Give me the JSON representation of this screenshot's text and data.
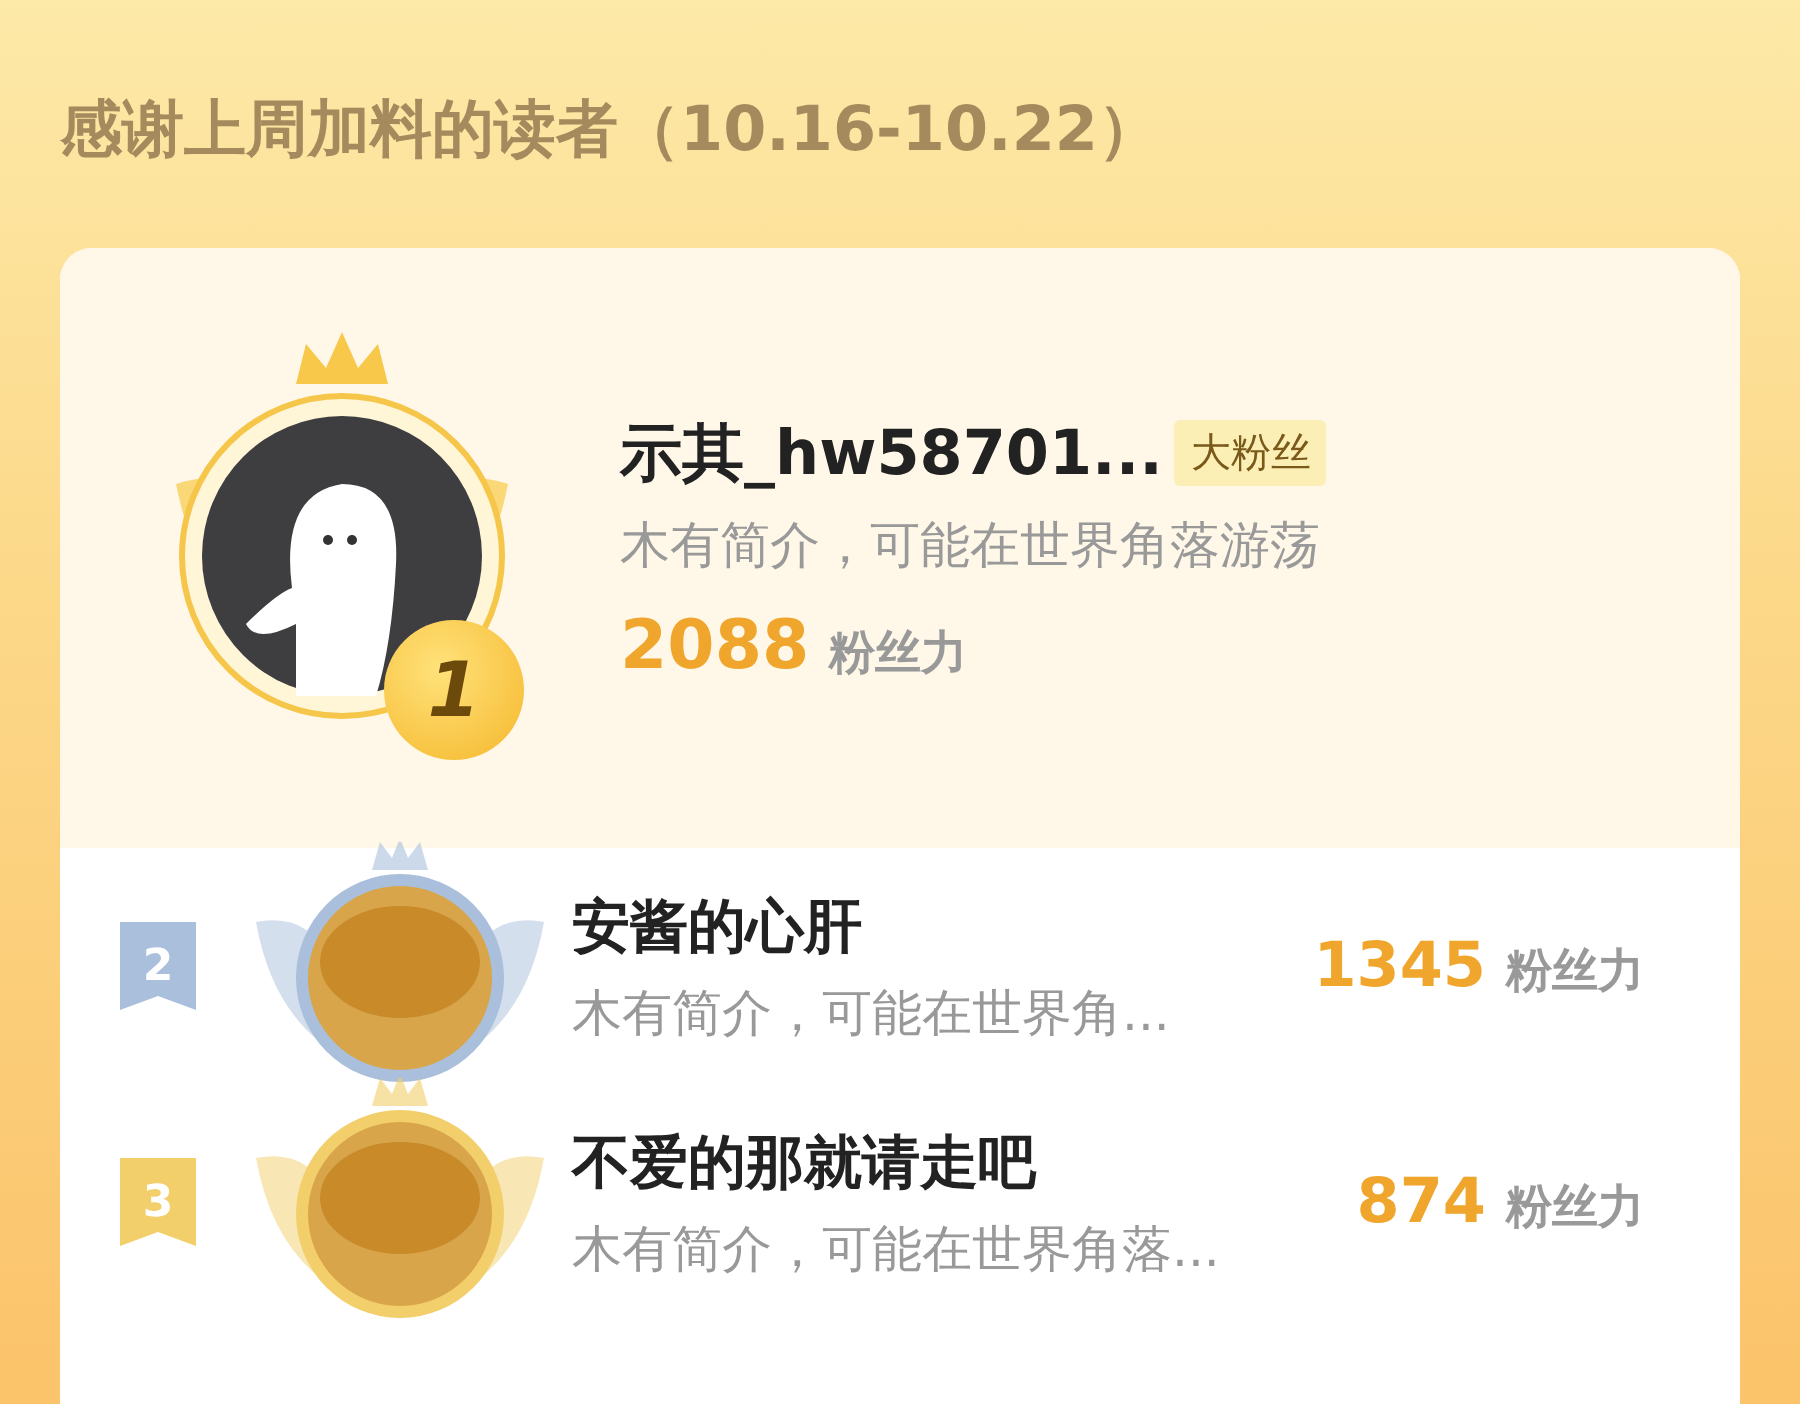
{
  "heading": "感谢上周加料的读者（10.16-10.22）",
  "top_reader": {
    "rank": "1",
    "name": "示其_hw58701...",
    "tag": "大粉丝",
    "bio": "木有简介，可能在世界角落游荡",
    "score": "2088",
    "unit": "粉丝力"
  },
  "readers": [
    {
      "rank": "2",
      "color": "#a9bfdc",
      "name": "安酱的心肝",
      "bio": "木有简介，可能在世界角...",
      "score": "1345",
      "unit": "粉丝力"
    },
    {
      "rank": "3",
      "color": "#f2cf6a",
      "name": "不爱的那就请走吧",
      "bio": "木有简介，可能在世界角落...",
      "score": "874",
      "unit": "粉丝力"
    }
  ]
}
